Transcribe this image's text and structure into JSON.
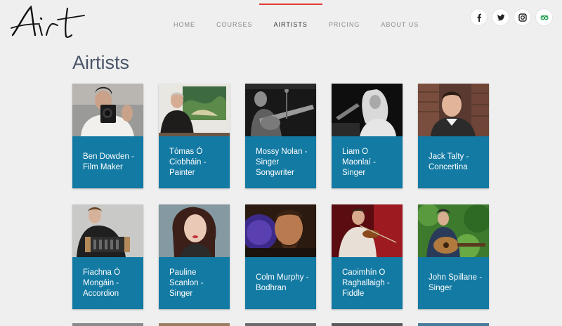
{
  "header": {
    "logo_text": "Airt",
    "nav": [
      {
        "label": "HOME",
        "active": false
      },
      {
        "label": "COURSES",
        "active": false
      },
      {
        "label": "AIRTISTS",
        "active": true
      },
      {
        "label": "PRICING",
        "active": false
      },
      {
        "label": "ABOUT US",
        "active": false
      }
    ],
    "social": [
      "facebook-icon",
      "twitter-icon",
      "instagram-icon",
      "tripadvisor-icon"
    ]
  },
  "page": {
    "title": "Airtists"
  },
  "artists": [
    {
      "name": "Ben Dowden - Film Maker"
    },
    {
      "name": "Tómas Ó Ciobháin - Painter"
    },
    {
      "name": "Mossy Nolan - Singer Songwriter"
    },
    {
      "name": "Liam O Maonlaí - Singer"
    },
    {
      "name": "Jack Talty - Concertina"
    },
    {
      "name": "Fiachna Ó Mongáin - Accordion"
    },
    {
      "name": "Pauline Scanlon - Singer"
    },
    {
      "name": "Colm Murphy - Bodhran"
    },
    {
      "name": "Caoimhín O Raghallaigh - Fiddle"
    },
    {
      "name": "John Spillane - Singer"
    }
  ],
  "colors": {
    "card": "#137aa3",
    "active_underline": "#e23a3a",
    "background": "#efefef"
  }
}
